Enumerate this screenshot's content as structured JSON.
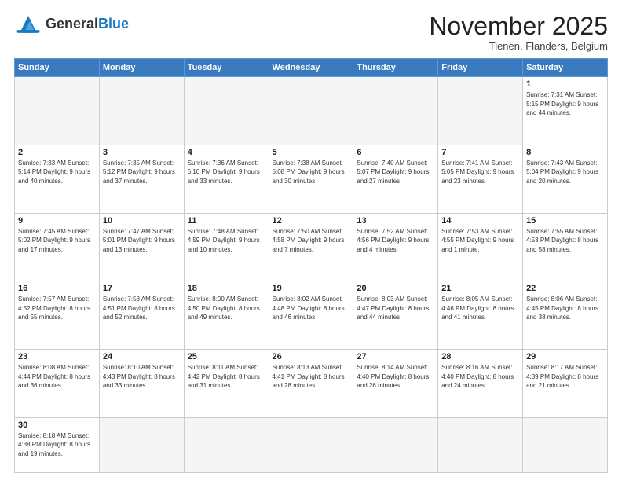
{
  "header": {
    "logo_general": "General",
    "logo_blue": "Blue",
    "month_title": "November 2025",
    "location": "Tienen, Flanders, Belgium"
  },
  "days_of_week": [
    "Sunday",
    "Monday",
    "Tuesday",
    "Wednesday",
    "Thursday",
    "Friday",
    "Saturday"
  ],
  "weeks": [
    [
      {
        "day": "",
        "info": "",
        "empty": true
      },
      {
        "day": "",
        "info": "",
        "empty": true
      },
      {
        "day": "",
        "info": "",
        "empty": true
      },
      {
        "day": "",
        "info": "",
        "empty": true
      },
      {
        "day": "",
        "info": "",
        "empty": true
      },
      {
        "day": "",
        "info": "",
        "empty": true
      },
      {
        "day": "1",
        "info": "Sunrise: 7:31 AM\nSunset: 5:15 PM\nDaylight: 9 hours\nand 44 minutes."
      }
    ],
    [
      {
        "day": "2",
        "info": "Sunrise: 7:33 AM\nSunset: 5:14 PM\nDaylight: 9 hours\nand 40 minutes."
      },
      {
        "day": "3",
        "info": "Sunrise: 7:35 AM\nSunset: 5:12 PM\nDaylight: 9 hours\nand 37 minutes."
      },
      {
        "day": "4",
        "info": "Sunrise: 7:36 AM\nSunset: 5:10 PM\nDaylight: 9 hours\nand 33 minutes."
      },
      {
        "day": "5",
        "info": "Sunrise: 7:38 AM\nSunset: 5:08 PM\nDaylight: 9 hours\nand 30 minutes."
      },
      {
        "day": "6",
        "info": "Sunrise: 7:40 AM\nSunset: 5:07 PM\nDaylight: 9 hours\nand 27 minutes."
      },
      {
        "day": "7",
        "info": "Sunrise: 7:41 AM\nSunset: 5:05 PM\nDaylight: 9 hours\nand 23 minutes."
      },
      {
        "day": "8",
        "info": "Sunrise: 7:43 AM\nSunset: 5:04 PM\nDaylight: 9 hours\nand 20 minutes."
      }
    ],
    [
      {
        "day": "9",
        "info": "Sunrise: 7:45 AM\nSunset: 5:02 PM\nDaylight: 9 hours\nand 17 minutes."
      },
      {
        "day": "10",
        "info": "Sunrise: 7:47 AM\nSunset: 5:01 PM\nDaylight: 9 hours\nand 13 minutes."
      },
      {
        "day": "11",
        "info": "Sunrise: 7:48 AM\nSunset: 4:59 PM\nDaylight: 9 hours\nand 10 minutes."
      },
      {
        "day": "12",
        "info": "Sunrise: 7:50 AM\nSunset: 4:58 PM\nDaylight: 9 hours\nand 7 minutes."
      },
      {
        "day": "13",
        "info": "Sunrise: 7:52 AM\nSunset: 4:56 PM\nDaylight: 9 hours\nand 4 minutes."
      },
      {
        "day": "14",
        "info": "Sunrise: 7:53 AM\nSunset: 4:55 PM\nDaylight: 9 hours\nand 1 minute."
      },
      {
        "day": "15",
        "info": "Sunrise: 7:55 AM\nSunset: 4:53 PM\nDaylight: 8 hours\nand 58 minutes."
      }
    ],
    [
      {
        "day": "16",
        "info": "Sunrise: 7:57 AM\nSunset: 4:52 PM\nDaylight: 8 hours\nand 55 minutes."
      },
      {
        "day": "17",
        "info": "Sunrise: 7:58 AM\nSunset: 4:51 PM\nDaylight: 8 hours\nand 52 minutes."
      },
      {
        "day": "18",
        "info": "Sunrise: 8:00 AM\nSunset: 4:50 PM\nDaylight: 8 hours\nand 49 minutes."
      },
      {
        "day": "19",
        "info": "Sunrise: 8:02 AM\nSunset: 4:48 PM\nDaylight: 8 hours\nand 46 minutes."
      },
      {
        "day": "20",
        "info": "Sunrise: 8:03 AM\nSunset: 4:47 PM\nDaylight: 8 hours\nand 44 minutes."
      },
      {
        "day": "21",
        "info": "Sunrise: 8:05 AM\nSunset: 4:46 PM\nDaylight: 8 hours\nand 41 minutes."
      },
      {
        "day": "22",
        "info": "Sunrise: 8:06 AM\nSunset: 4:45 PM\nDaylight: 8 hours\nand 38 minutes."
      }
    ],
    [
      {
        "day": "23",
        "info": "Sunrise: 8:08 AM\nSunset: 4:44 PM\nDaylight: 8 hours\nand 36 minutes."
      },
      {
        "day": "24",
        "info": "Sunrise: 8:10 AM\nSunset: 4:43 PM\nDaylight: 8 hours\nand 33 minutes."
      },
      {
        "day": "25",
        "info": "Sunrise: 8:11 AM\nSunset: 4:42 PM\nDaylight: 8 hours\nand 31 minutes."
      },
      {
        "day": "26",
        "info": "Sunrise: 8:13 AM\nSunset: 4:41 PM\nDaylight: 8 hours\nand 28 minutes."
      },
      {
        "day": "27",
        "info": "Sunrise: 8:14 AM\nSunset: 4:40 PM\nDaylight: 8 hours\nand 26 minutes."
      },
      {
        "day": "28",
        "info": "Sunrise: 8:16 AM\nSunset: 4:40 PM\nDaylight: 8 hours\nand 24 minutes."
      },
      {
        "day": "29",
        "info": "Sunrise: 8:17 AM\nSunset: 4:39 PM\nDaylight: 8 hours\nand 21 minutes."
      }
    ],
    [
      {
        "day": "30",
        "info": "Sunrise: 8:18 AM\nSunset: 4:38 PM\nDaylight: 8 hours\nand 19 minutes.",
        "last": true
      },
      {
        "day": "",
        "info": "",
        "empty": true,
        "last": true
      },
      {
        "day": "",
        "info": "",
        "empty": true,
        "last": true
      },
      {
        "day": "",
        "info": "",
        "empty": true,
        "last": true
      },
      {
        "day": "",
        "info": "",
        "empty": true,
        "last": true
      },
      {
        "day": "",
        "info": "",
        "empty": true,
        "last": true
      },
      {
        "day": "",
        "info": "",
        "empty": true,
        "last": true
      }
    ]
  ]
}
